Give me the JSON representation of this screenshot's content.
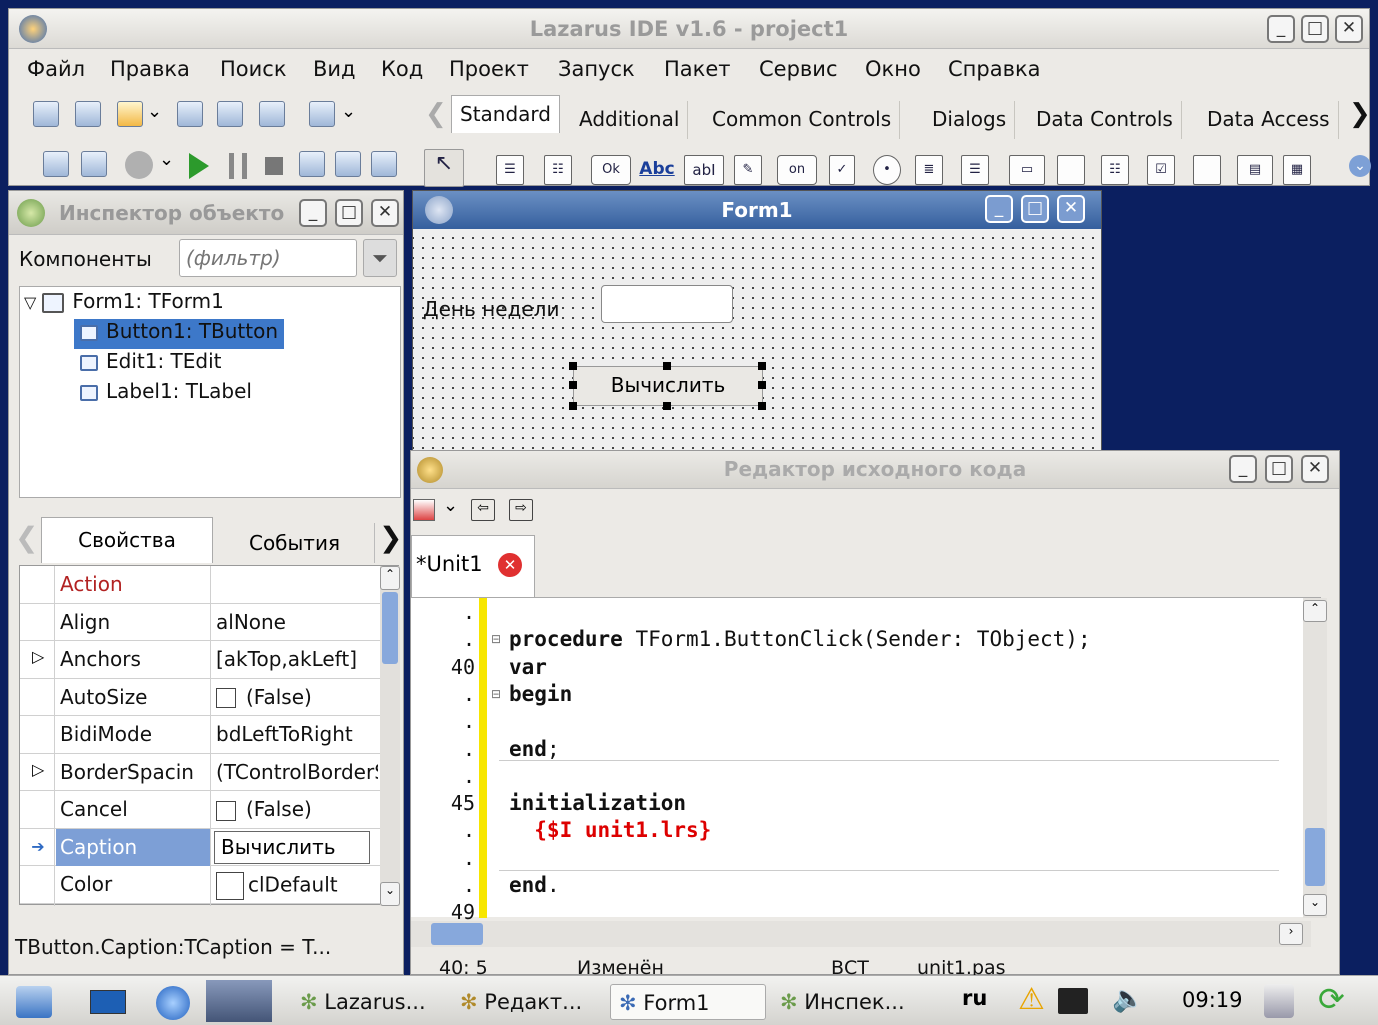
{
  "window": {
    "title": "Lazarus IDE v1.6 - project1"
  },
  "menu": [
    "Файл",
    "Правка",
    "Поиск",
    "Вид",
    "Код",
    "Проект",
    "Запуск",
    "Пакет",
    "Сервис",
    "Окно",
    "Справка"
  ],
  "palette": {
    "tabs": [
      "Standard",
      "Additional",
      "Common Controls",
      "Dialogs",
      "Data Controls",
      "Data Access"
    ],
    "active_tab": "Standard",
    "icon_labels": {
      "button": "Ok",
      "label": "Abc",
      "edit": "abI",
      "toggle": "on"
    }
  },
  "inspector": {
    "title": "Инспектор объекто",
    "components_label": "Компоненты",
    "filter_placeholder": "(фильтр)",
    "tree": {
      "root": "Form1: TForm1",
      "children": [
        "Button1: TButton",
        "Edit1: TEdit",
        "Label1: TLabel"
      ]
    },
    "tabs": [
      "Свойства",
      "События"
    ],
    "properties": [
      {
        "name": "Action",
        "value": ""
      },
      {
        "name": "Align",
        "value": "alNone"
      },
      {
        "name": "Anchors",
        "value": "[akTop,akLeft]"
      },
      {
        "name": "AutoSize",
        "value": "(False)"
      },
      {
        "name": "BidiMode",
        "value": "bdLeftToRight"
      },
      {
        "name": "BorderSpacin",
        "value": "(TControlBorderSpacing)"
      },
      {
        "name": "Cancel",
        "value": "(False)"
      },
      {
        "name": "Caption",
        "value": "Вычислить"
      },
      {
        "name": "Color",
        "value": "clDefault"
      }
    ],
    "status": "TButton.Caption:TCaption = T..."
  },
  "form1": {
    "title": "Form1",
    "label": "День недели",
    "button": "Вычислить"
  },
  "editor": {
    "title": "Редактор исходного кода",
    "tab": "*Unit1",
    "lines": [
      {
        "num": ".",
        "parts": []
      },
      {
        "num": ".",
        "parts": [
          {
            "t": "procedure",
            "c": "kw"
          },
          {
            "t": " TForm1.ButtonClick(Sender: TObject);",
            "c": ""
          }
        ]
      },
      {
        "num": "40",
        "parts": [
          {
            "t": "var",
            "c": "kw"
          }
        ]
      },
      {
        "num": ".",
        "parts": [
          {
            "t": "begin",
            "c": "kw"
          }
        ]
      },
      {
        "num": ".",
        "parts": []
      },
      {
        "num": ".",
        "parts": [
          {
            "t": "end",
            "c": "kw"
          },
          {
            "t": ";",
            "c": ""
          }
        ]
      },
      {
        "num": ".",
        "parts": []
      },
      {
        "num": "45",
        "parts": [
          {
            "t": "initialization",
            "c": "kw"
          }
        ]
      },
      {
        "num": ".",
        "parts": [
          {
            "t": "  {$I unit1.lrs}",
            "c": "dir"
          }
        ]
      },
      {
        "num": ".",
        "parts": []
      },
      {
        "num": ".",
        "parts": [
          {
            "t": "end",
            "c": "kw"
          },
          {
            "t": ".",
            "c": ""
          }
        ]
      },
      {
        "num": "49",
        "parts": []
      }
    ],
    "status": {
      "pos": "40:  5",
      "modified": "Изменён",
      "mode": "ВСТ",
      "file": "unit1.pas"
    }
  },
  "taskbar": {
    "tasks": [
      "Lazarus...",
      "Редакт...",
      "Form1",
      "Инспек..."
    ],
    "active_task": "Form1",
    "lang": "ru",
    "time": "09:19"
  }
}
